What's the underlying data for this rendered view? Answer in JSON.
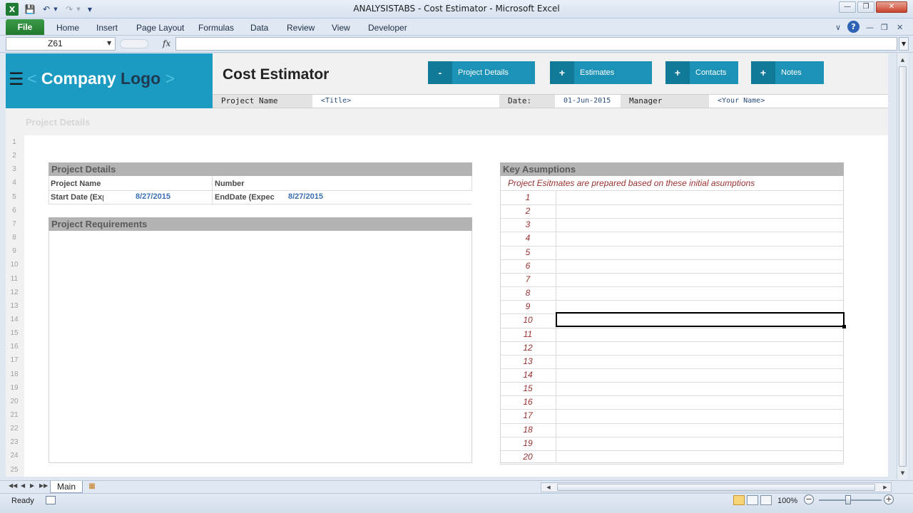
{
  "window": {
    "title": "ANALYSISTABS - Cost Estimator - Microsoft Excel",
    "controls": [
      "minimize",
      "restore",
      "close"
    ]
  },
  "quick_access": {
    "icons": [
      "excel-icon",
      "save-icon",
      "undo-icon",
      "redo-icon",
      "customize-icon"
    ]
  },
  "ribbon": {
    "file_label": "File",
    "tabs": [
      "Home",
      "Insert",
      "Page Layout",
      "Formulas",
      "Data",
      "Review",
      "View",
      "Developer"
    ]
  },
  "formula_bar": {
    "name_box": "Z61",
    "fx_label": "fx",
    "formula": ""
  },
  "sheet": {
    "logo": {
      "left_bracket": "<",
      "word1": "Company",
      "word2": "Logo",
      "right_bracket": ">"
    },
    "app_title": "Cost Estimator",
    "nav_buttons": [
      {
        "sign": "-",
        "label": "Project Details"
      },
      {
        "sign": "+",
        "label": "Estimates"
      },
      {
        "sign": "+",
        "label": "Contacts"
      },
      {
        "sign": "+",
        "label": "Notes"
      }
    ],
    "header_row": {
      "project_name_label": "Project Name",
      "project_name_value": "<Title>",
      "date_label": "Date:",
      "date_value": "01-Jun-2015",
      "manager_label": "Manager",
      "manager_value": "<Your Name>"
    },
    "section_title_faded": "Project Details",
    "row_numbers": [
      "1",
      "2",
      "3",
      "4",
      "5",
      "6",
      "7",
      "8",
      "9",
      "10",
      "11",
      "12",
      "13",
      "14",
      "15",
      "16",
      "17",
      "18",
      "19",
      "20",
      "21",
      "22",
      "23",
      "24",
      "25"
    ],
    "project_details": {
      "header": "Project Details",
      "project_name_label": "Project Name",
      "number_label": "Number",
      "start_date_label": "Start Date (Expected)",
      "start_date_value": "8/27/2015",
      "end_date_label": "EndDate (Expected)",
      "end_date_value": "8/27/2015"
    },
    "project_requirements": {
      "header": "Project Requirements"
    },
    "key_assumptions": {
      "header": "Key Asumptions",
      "note": "Project Esitmates are prepared based on these initial asumptions",
      "numbers": [
        "1",
        "2",
        "3",
        "4",
        "5",
        "6",
        "7",
        "8",
        "9",
        "10",
        "11",
        "12",
        "13",
        "14",
        "15",
        "16",
        "17",
        "18",
        "19",
        "20"
      ],
      "selected_row": "10"
    }
  },
  "sheet_tabs": {
    "active": "Main"
  },
  "status_bar": {
    "status": "Ready",
    "zoom": "100%",
    "zoom_out": "−",
    "zoom_in": "+"
  }
}
